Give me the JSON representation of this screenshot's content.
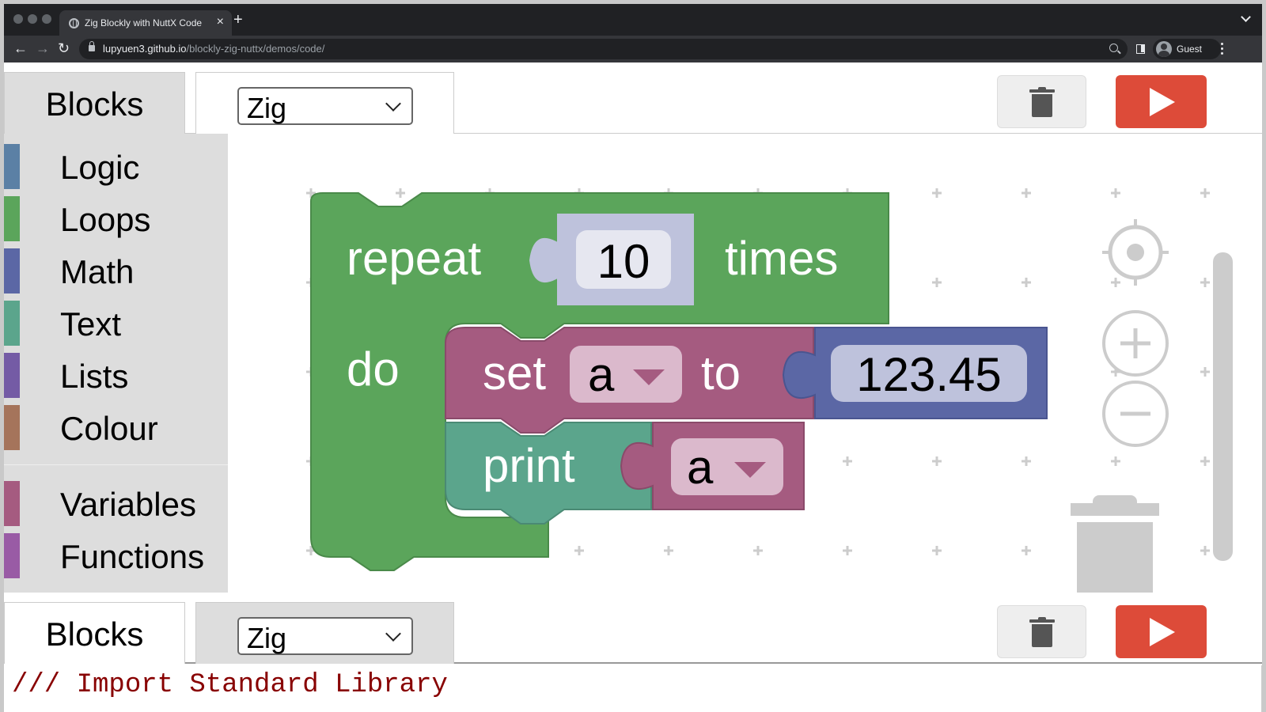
{
  "browser": {
    "tab_title": "Zig Blockly with NuttX Code",
    "url_host": "lupyuen3.github.io",
    "url_path": "/blockly-zig-nuttx/demos/code/",
    "profile_name": "Guest",
    "icons": {
      "back": "←",
      "forward": "→",
      "reload": "↻",
      "new_tab": "+",
      "close_tab": "×"
    }
  },
  "top_bar": {
    "blocks_tab_label": "Blocks",
    "language_select_value": "Zig",
    "trash_button": "trash-icon",
    "run_button": "play-icon"
  },
  "bottom_bar": {
    "blocks_tab_label": "Blocks",
    "language_select_value": "Zig",
    "trash_button": "trash-icon",
    "run_button": "play-icon"
  },
  "toolbox": {
    "categories": [
      {
        "name": "Logic",
        "color": "#5b80a5"
      },
      {
        "name": "Loops",
        "color": "#5ba55b"
      },
      {
        "name": "Math",
        "color": "#5b67a5"
      },
      {
        "name": "Text",
        "color": "#5ba58c"
      },
      {
        "name": "Lists",
        "color": "#745ba5"
      },
      {
        "name": "Colour",
        "color": "#a5745b"
      },
      {
        "name": "Variables",
        "color": "#a55b80"
      },
      {
        "name": "Functions",
        "color": "#995ba5"
      }
    ]
  },
  "workspace": {
    "blocks": {
      "repeat": {
        "label_before": "repeat",
        "count": "10",
        "label_after": "times",
        "do_label": "do",
        "color": "#5ba55b"
      },
      "set": {
        "label": "set",
        "variable": "a",
        "to_label": "to",
        "value": "123.45",
        "color": "#a55b80",
        "value_color": "#5b67a5"
      },
      "print": {
        "label": "print",
        "variable": "a",
        "color": "#5ba58c",
        "var_color": "#a55b80"
      }
    },
    "controls": [
      "recenter-icon",
      "zoom-in-icon",
      "zoom-out-icon"
    ]
  },
  "code": {
    "first_line": "/// Import Standard Library"
  },
  "colors": {
    "run_red": "#dd4b39",
    "code_comment": "#880000"
  }
}
